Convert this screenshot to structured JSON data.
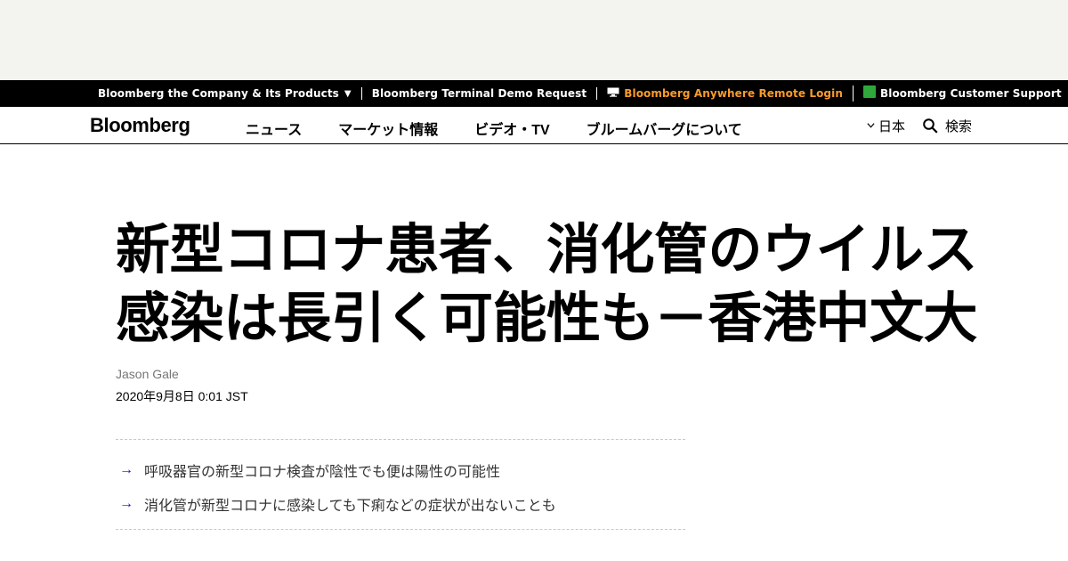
{
  "topbar": {
    "items": [
      {
        "label": "Bloomberg the Company & Its Products",
        "caret": "▼"
      },
      {
        "label": "Bloomberg Terminal Demo Request"
      },
      {
        "label": "Bloomberg Anywhere Remote Login",
        "icon": "monitor-icon",
        "color": "#fa9b2c"
      },
      {
        "label": "Bloomberg Customer Support",
        "icon": "green-square-icon",
        "icon_color": "#2fa73a"
      }
    ]
  },
  "nav": {
    "logo": "Bloomberg",
    "links": [
      "ニュース",
      "マーケット情報",
      "ビデオ・TV",
      "ブルームバーグについて"
    ],
    "language": "日本",
    "search_label": "検索"
  },
  "article": {
    "headline_line1": "新型コロナ患者、消化管のウイルス",
    "headline_line2": "感染は長引く可能性も－香港中文大",
    "author": "Jason Gale",
    "date": "2020年9月8日 0:01 JST",
    "bullets": [
      "呼吸器官の新型コロナ検査が陰性でも便は陽性の可能性",
      "消化管が新型コロナに感染しても下痢などの症状が出ないことも"
    ],
    "bullet_arrow": "→",
    "accent_color": "#2800d7"
  }
}
